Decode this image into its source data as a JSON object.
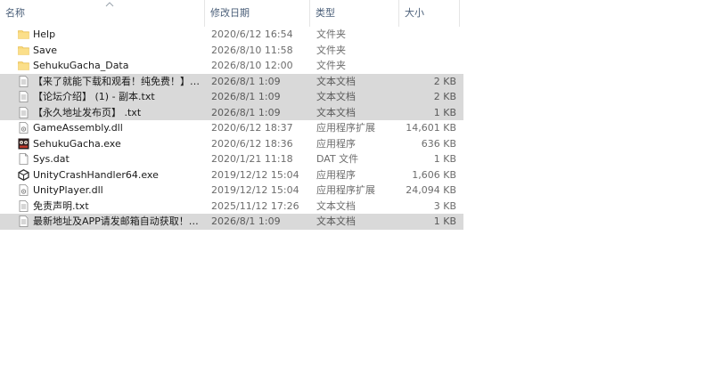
{
  "columns": {
    "name": "名称",
    "date": "修改日期",
    "type": "类型",
    "size": "大小"
  },
  "files": [
    {
      "name": "Help",
      "date": "2020/6/12 16:54",
      "type": "文件夹",
      "size": "",
      "icon": "folder-icon",
      "selected": false
    },
    {
      "name": "Save",
      "date": "2026/8/10 11:58",
      "type": "文件夹",
      "size": "",
      "icon": "folder-icon",
      "selected": false
    },
    {
      "name": "SehukuGacha_Data",
      "date": "2026/8/10 12:00",
      "type": "文件夹",
      "size": "",
      "icon": "folder-icon",
      "selected": false
    },
    {
      "name": "【来了就能下载和观看！纯免费！】 - 副...",
      "date": "2026/8/1 1:09",
      "type": "文本文档",
      "size": "2 KB",
      "icon": "text-file-icon",
      "selected": true
    },
    {
      "name": "【论坛介绍】 (1) - 副本.txt",
      "date": "2026/8/1 1:09",
      "type": "文本文档",
      "size": "2 KB",
      "icon": "text-file-icon",
      "selected": true
    },
    {
      "name": "【永久地址发布页】 .txt",
      "date": "2026/8/1 1:09",
      "type": "文本文档",
      "size": "1 KB",
      "icon": "text-file-icon",
      "selected": true
    },
    {
      "name": "GameAssembly.dll",
      "date": "2020/6/12 18:37",
      "type": "应用程序扩展",
      "size": "14,601 KB",
      "icon": "dll-file-icon",
      "selected": false
    },
    {
      "name": "SehukuGacha.exe",
      "date": "2020/6/12 18:36",
      "type": "应用程序",
      "size": "636 KB",
      "icon": "game-app-icon",
      "selected": false
    },
    {
      "name": "Sys.dat",
      "date": "2020/1/21 11:18",
      "type": "DAT 文件",
      "size": "1 KB",
      "icon": "blank-file-icon",
      "selected": false
    },
    {
      "name": "UnityCrashHandler64.exe",
      "date": "2019/12/12 15:04",
      "type": "应用程序",
      "size": "1,606 KB",
      "icon": "unity-icon",
      "selected": false
    },
    {
      "name": "UnityPlayer.dll",
      "date": "2019/12/12 15:04",
      "type": "应用程序扩展",
      "size": "24,094 KB",
      "icon": "dll-file-icon",
      "selected": false
    },
    {
      "name": "免责声明.txt",
      "date": "2025/11/12 17:26",
      "type": "文本文档",
      "size": "3 KB",
      "icon": "text-file-icon",
      "selected": false
    },
    {
      "name": "最新地址及APP请发邮箱自动获取！！！...",
      "date": "2026/8/1 1:09",
      "type": "文本文档",
      "size": "1 KB",
      "icon": "text-file-icon",
      "selected": true
    }
  ],
  "colors": {
    "header_text": "#4c607a",
    "selection": "#d9d9d9",
    "folder": "#f8d775"
  }
}
